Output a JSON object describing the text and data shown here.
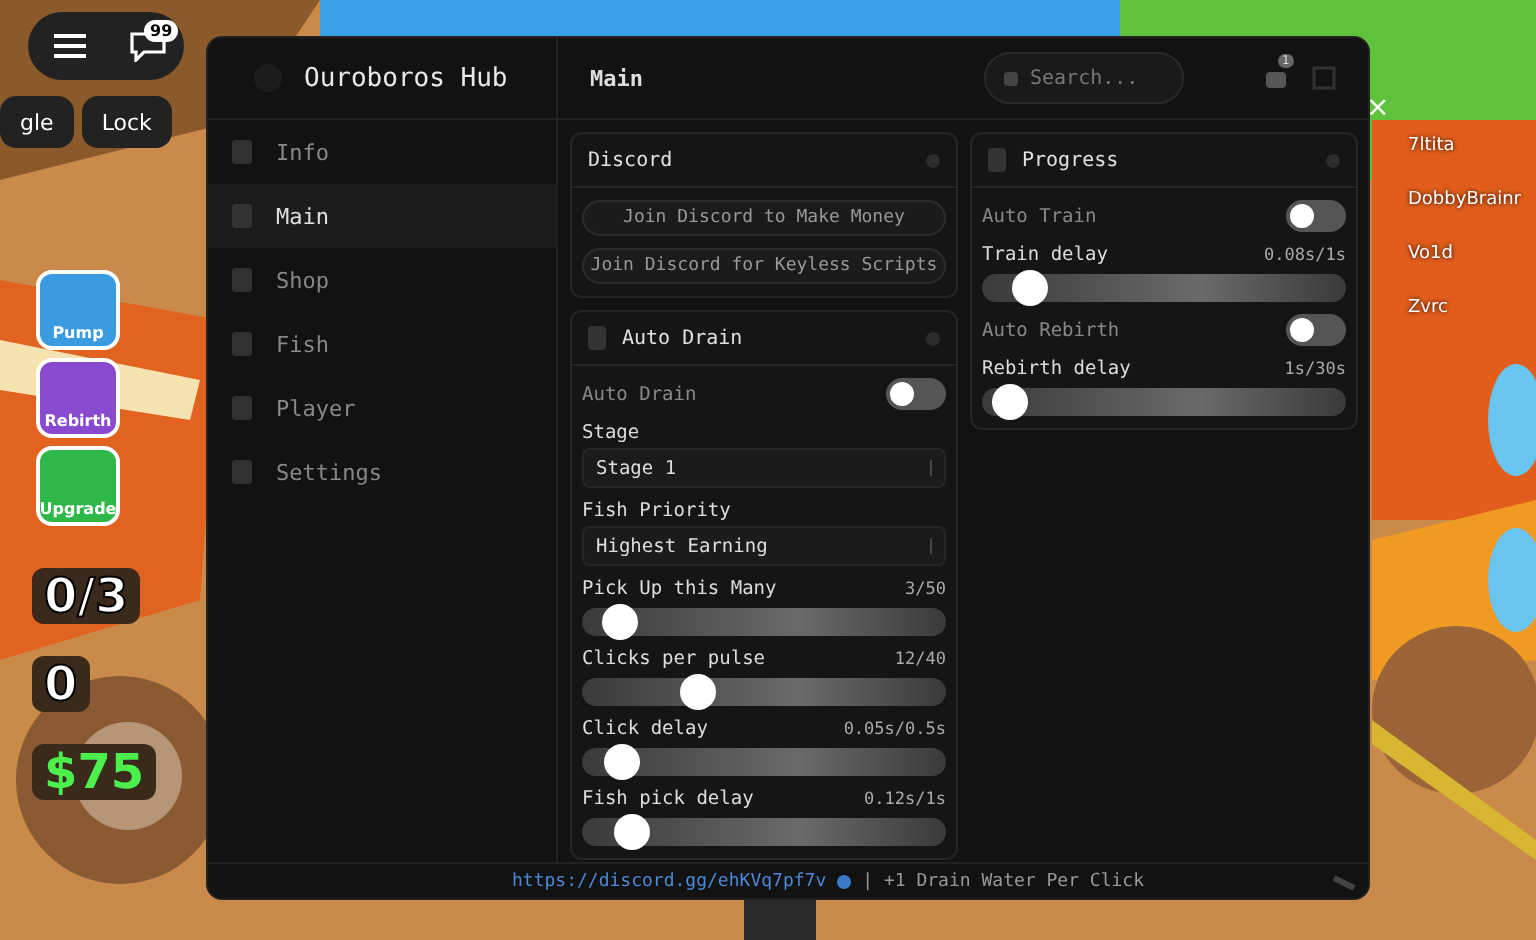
{
  "hud": {
    "chat_badge": "99",
    "buttons": [
      "gle",
      "Lock"
    ],
    "actions": [
      "Pump",
      "Rebirth",
      "Upgrade"
    ],
    "stats": [
      "0/3",
      "0",
      "$75"
    ],
    "close": "×",
    "players": [
      "7ltita",
      "DobbyBrainr",
      "Vo1d",
      "Zvrc"
    ]
  },
  "hub": {
    "title": "Ouroboros Hub",
    "nav": [
      {
        "label": "Info",
        "selected": false
      },
      {
        "label": "Main",
        "selected": true
      },
      {
        "label": "Shop",
        "selected": false
      },
      {
        "label": "Fish",
        "selected": false
      },
      {
        "label": "Player",
        "selected": false
      },
      {
        "label": "Settings",
        "selected": false
      }
    ],
    "page_title": "Main",
    "search": {
      "placeholder": "Search..."
    },
    "notification_count": "1",
    "columns": [
      [
        {
          "title": "Discord",
          "icon": false,
          "items": [
            {
              "kind": "button",
              "label": "Join Discord to Make Money"
            },
            {
              "kind": "button",
              "label": "Join Discord for Keyless Scripts"
            }
          ]
        },
        {
          "title": "Auto Drain",
          "icon": true,
          "items": [
            {
              "kind": "toggle",
              "label": "Auto Drain",
              "on": false
            },
            {
              "kind": "dropdown",
              "label": "Stage",
              "value": "Stage 1"
            },
            {
              "kind": "dropdown",
              "label": "Fish Priority",
              "value": "Highest Earning"
            },
            {
              "kind": "slider",
              "label": "Pick Up this Many",
              "reading": "3/50",
              "level": 0.06
            },
            {
              "kind": "slider",
              "label": "Clicks per pulse",
              "reading": "12/40",
              "level": 0.3
            },
            {
              "kind": "slider",
              "label": "Click delay",
              "reading": "0.05s/0.5s",
              "level": 0.07
            },
            {
              "kind": "slider",
              "label": "Fish pick delay",
              "reading": "0.12s/1s",
              "level": 0.1
            }
          ]
        }
      ],
      [
        {
          "title": "Progress",
          "icon": true,
          "items": [
            {
              "kind": "toggle",
              "label": "Auto Train",
              "on": false
            },
            {
              "kind": "slider",
              "label": "Train delay",
              "reading": "0.08s/1s",
              "level": 0.09
            },
            {
              "kind": "toggle",
              "label": "Auto Rebirth",
              "on": false
            },
            {
              "kind": "slider",
              "label": "Rebirth delay",
              "reading": "1s/30s",
              "level": 0.03
            }
          ]
        }
      ]
    ],
    "footer": {
      "link": "https://discord.gg/ehKVq7pf7v",
      "text": "| +1 Drain Water Per Click"
    }
  }
}
